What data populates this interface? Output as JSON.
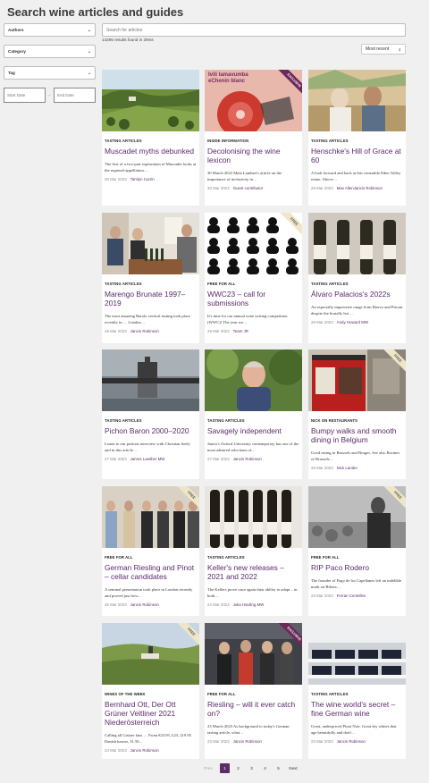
{
  "page": {
    "title": "Search wine articles and guides"
  },
  "filters": {
    "authors": "Authors",
    "category": "Category",
    "tag": "Tag",
    "start_date": "Start Date",
    "end_date": "End Date",
    "date_separator": "-"
  },
  "search": {
    "placeholder": "Search for articles",
    "results": "14295 results found in 29ms"
  },
  "sort": {
    "label": "Most recent"
  },
  "articles": [
    {
      "category": "TASTING ARTICLES",
      "title": "Muscadet myths debunked",
      "excerpt": "The first of a two-part exploration of Muscadet looks at the regional-appellation…",
      "date": "30 Mar 2023",
      "author": "Tamlyn Currin",
      "badge": ""
    },
    {
      "category": "INSIDE INFORMATION",
      "title": "Decolonising the wine lexicon",
      "excerpt": "30 March 2023 Mala Lambert's article on the importance of inclusivity in…",
      "date": "30 Mar 2023",
      "author": "Guest contributor",
      "badge": "EXCLUSIVE",
      "image_text": "Ivili lamavumba eChenin blanc"
    },
    {
      "category": "TASTING ARTICLES",
      "title": "Henschke's Hill of Grace at 60",
      "excerpt": "A look forward and back at this venerable Eden Valley estate. Above…",
      "date": "29 Mar 2023",
      "author": "Max AllenJancis Robinson",
      "badge": ""
    },
    {
      "category": "TASTING ARTICLES",
      "title": "Marengo Brunate 1997–2019",
      "excerpt": "The most amazing Barolo vertical tasting took place recently in … London…",
      "date": "29 Mar 2023",
      "author": "Jancis Robinson",
      "badge": ""
    },
    {
      "category": "FREE FOR ALL",
      "title": "WWC23 – call for submissions",
      "excerpt": "It's time for our annual wine writing competition (WWC)! The year we…",
      "date": "28 Mar 2023",
      "author": "Team JR",
      "badge": "FREE"
    },
    {
      "category": "TASTING ARTICLES",
      "title": "Álvaro Palacios's 2022s",
      "excerpt": "An especially impressive range from Bierzo and Priorat despite the brutally hot…",
      "date": "28 Mar 2023",
      "author": "Andy Howard MW",
      "badge": ""
    },
    {
      "category": "TASTING ARTICLES",
      "title": "Pichon Baron 2000–2020",
      "excerpt": "Listen to our podcast interview with Christian Seely and in this article…",
      "date": "27 Mar 2023",
      "author": "James Lawther MW",
      "badge": ""
    },
    {
      "category": "TASTING ARTICLES",
      "title": "Savagely independent",
      "excerpt": "Jancis's Oxford University contemporary has one of the most admired selections of…",
      "date": "27 Mar 2023",
      "author": "Jancis Robinson",
      "badge": ""
    },
    {
      "category": "NICK ON RESTAURANTS",
      "title": "Bumpy walks and smooth dining in Belgium",
      "excerpt": "Good eating in Brussels and Bruges. See also Racines of Brussels…",
      "date": "25 Mar 2023",
      "author": "Nick Lander",
      "badge": "FREE"
    },
    {
      "category": "FREE FOR ALL",
      "title": "German Riesling and Pinot – cellar candidates",
      "excerpt": "A seminal presentation took place in London recently and proved just how…",
      "date": "25 Mar 2023",
      "author": "Jancis Robinson",
      "badge": "FREE"
    },
    {
      "category": "TASTING ARTICLES",
      "title": "Keller's new releases – 2021 and 2022",
      "excerpt": "The Kellers prove once again their ability to adapt – in both…",
      "date": "24 Mar 2023",
      "author": "Julia Harding MW",
      "badge": ""
    },
    {
      "category": "FREE FOR ALL",
      "title": "RIP Paco Rodero",
      "excerpt": "The founder of Pago de los Capellanes left an indelible mark on Ribera…",
      "date": "24 Mar 2023",
      "author": "Ferran Centelles",
      "badge": "FREE"
    },
    {
      "category": "WINES OF THE WEEK",
      "title": "Bernhard Ott, Der Ott Grüner Veltliner 2021 Niederösterreich",
      "excerpt": "Calling all Grüner fans … From €23.95, £23, 219.95 Danish kroner, 31.50…",
      "date": "24 Mar 2023",
      "author": "Jancis Robinson",
      "badge": "FREE"
    },
    {
      "category": "FREE FOR ALL",
      "title": "Riesling – will it ever catch on?",
      "excerpt": "23 March 2023 As background to today's German tasting article, what…",
      "date": "23 Mar 2023",
      "author": "Jancis Robinson",
      "badge": "EXCLUSIVE"
    },
    {
      "category": "TASTING ARTICLES",
      "title": "The wine world's secret – fine German wine",
      "excerpt": "Great, underpriced Pinot Noir. Great dry whites that age beautifully and don't…",
      "date": "23 Mar 2023",
      "author": "Jancis Robinson",
      "badge": ""
    }
  ],
  "pagination": {
    "prev": "Prev",
    "pages": [
      "1",
      "2",
      "3",
      "4",
      "5"
    ],
    "current": "1",
    "next": "Next"
  },
  "colors": {
    "accent": "#5b2b6a",
    "background": "#f0f0f0"
  }
}
